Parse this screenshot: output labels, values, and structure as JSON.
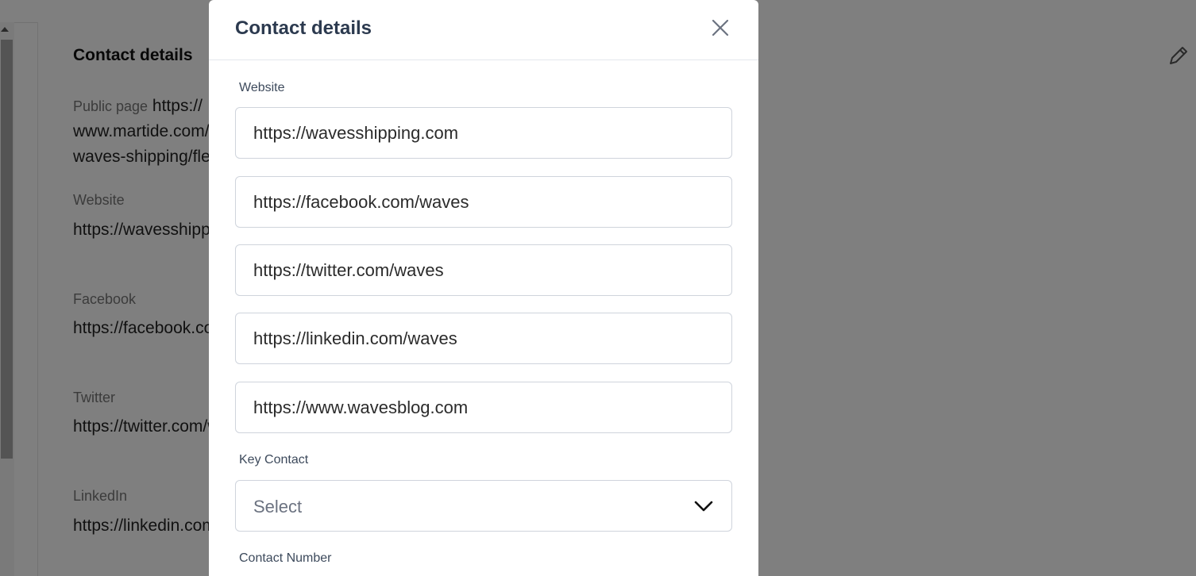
{
  "background": {
    "section_title": "Contact details",
    "public_page": {
      "label": "Public page",
      "line1": "https://",
      "line2": "www.martide.com/",
      "line3": "waves-shipping/fle"
    },
    "fields": [
      {
        "label": "Website",
        "value": "https://wavesshipping.com"
      },
      {
        "label": "Facebook",
        "value": "https://facebook.com/waves"
      },
      {
        "label": "Twitter",
        "value": "https://twitter.com/waves"
      },
      {
        "label": "LinkedIn",
        "value": "https://linkedin.com/waves"
      }
    ]
  },
  "modal": {
    "title": "Contact details",
    "website_label": "Website",
    "inputs": [
      "https://wavesshipping.com",
      "https://facebook.com/waves",
      "https://twitter.com/waves",
      "https://linkedin.com/waves",
      "https://www.wavesblog.com"
    ],
    "key_contact_label": "Key Contact",
    "key_contact_value": "Select",
    "contact_number_label": "Contact Number"
  },
  "icons": {
    "close": "close-icon",
    "edit": "pencil-icon",
    "dropdown": "chevron-down-icon"
  },
  "colors": {
    "overlay": "#000000",
    "title": "#2c3a4f",
    "input_border": "#cfd4dc"
  }
}
